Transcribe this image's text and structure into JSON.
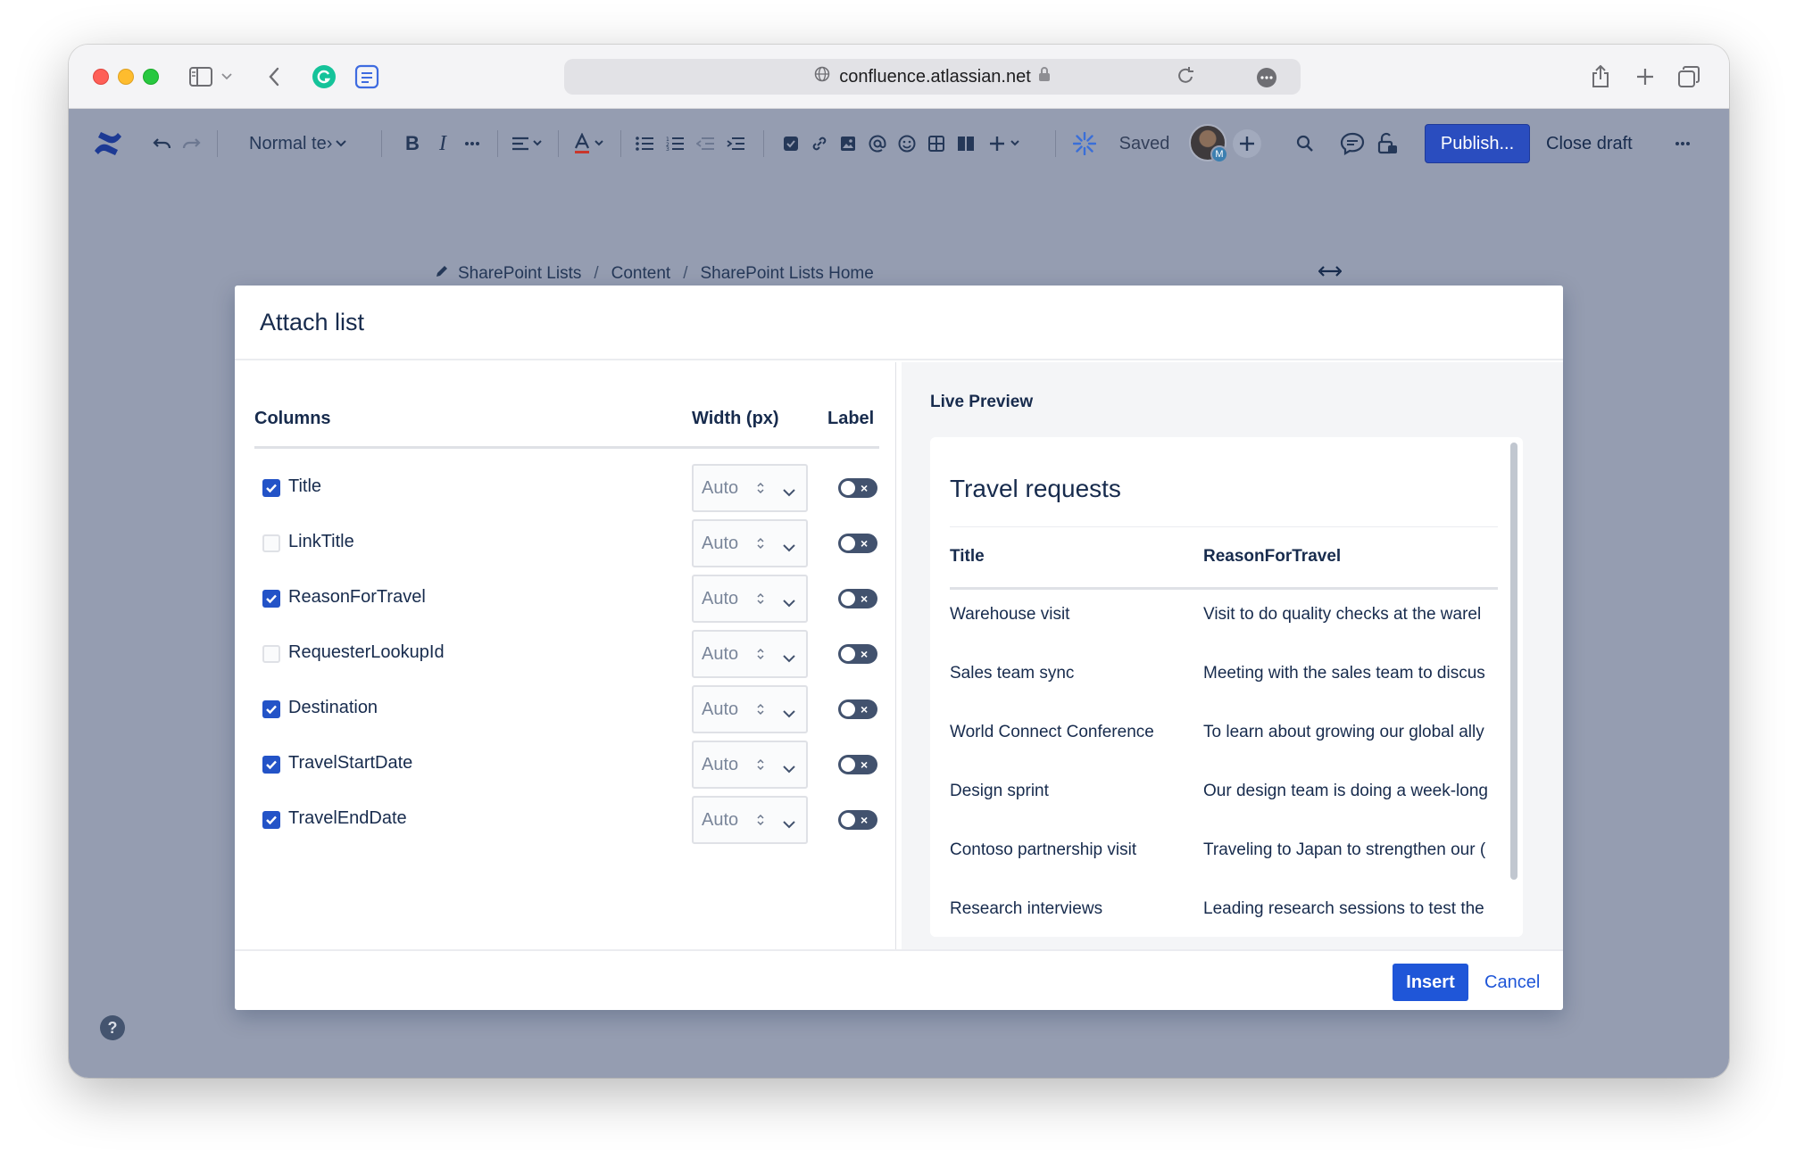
{
  "browser": {
    "url": "confluence.atlassian.net"
  },
  "toolbar": {
    "text_style": "Normal te›",
    "saved_label": "Saved",
    "avatar_badge": "M",
    "publish_label": "Publish...",
    "close_draft_label": "Close draft"
  },
  "breadcrumb": {
    "items": [
      "SharePoint Lists",
      "Content",
      "SharePoint Lists Home"
    ],
    "separator": "/"
  },
  "modal": {
    "title": "Attach list",
    "headers": {
      "columns": "Columns",
      "width": "Width (px)",
      "label": "Label"
    },
    "rows": [
      {
        "name": "Title",
        "checked": true,
        "width": "Auto",
        "label_on": false
      },
      {
        "name": "LinkTitle",
        "checked": false,
        "width": "Auto",
        "label_on": false
      },
      {
        "name": "ReasonForTravel",
        "checked": true,
        "width": "Auto",
        "label_on": false
      },
      {
        "name": "RequesterLookupId",
        "checked": false,
        "width": "Auto",
        "label_on": false
      },
      {
        "name": "Destination",
        "checked": true,
        "width": "Auto",
        "label_on": false
      },
      {
        "name": "TravelStartDate",
        "checked": true,
        "width": "Auto",
        "label_on": false
      },
      {
        "name": "TravelEndDate",
        "checked": true,
        "width": "Auto",
        "label_on": false
      }
    ],
    "preview": {
      "label": "Live Preview",
      "title": "Travel requests",
      "headers": [
        "Title",
        "ReasonForTravel"
      ],
      "rows": [
        [
          "Warehouse visit",
          "Visit to do quality checks at the warel"
        ],
        [
          "Sales team sync",
          "Meeting with the sales team to discus"
        ],
        [
          "World Connect Conference",
          "To learn about growing our global ally"
        ],
        [
          "Design sprint",
          "Our design team is doing a week-long"
        ],
        [
          "Contoso partnership visit",
          "Traveling to Japan to strengthen our ("
        ],
        [
          "Research interviews",
          "Leading research sessions to test the"
        ]
      ]
    },
    "footer": {
      "insert_label": "Insert",
      "cancel_label": "Cancel"
    }
  },
  "help": {
    "label": "?"
  },
  "colors": {
    "editor_bg": "#959db1",
    "primary": "#2a4dbf",
    "checkbox_on": "#2353c7",
    "toggle_off": "#42526e",
    "link": "#1f56d8"
  }
}
